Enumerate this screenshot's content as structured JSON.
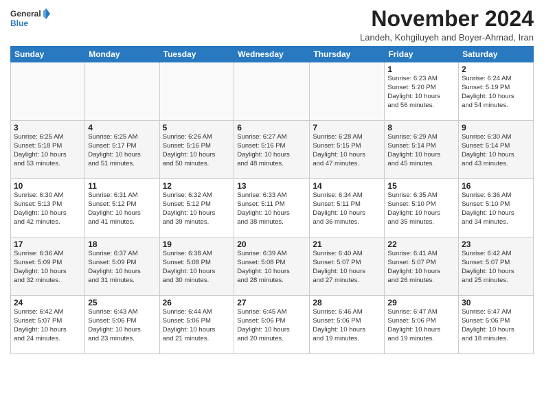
{
  "header": {
    "logo_line1": "General",
    "logo_line2": "Blue",
    "month": "November 2024",
    "location": "Landeh, Kohgiluyeh and Boyer-Ahmad, Iran"
  },
  "weekdays": [
    "Sunday",
    "Monday",
    "Tuesday",
    "Wednesday",
    "Thursday",
    "Friday",
    "Saturday"
  ],
  "weeks": [
    [
      {
        "day": "",
        "info": ""
      },
      {
        "day": "",
        "info": ""
      },
      {
        "day": "",
        "info": ""
      },
      {
        "day": "",
        "info": ""
      },
      {
        "day": "",
        "info": ""
      },
      {
        "day": "1",
        "info": "Sunrise: 6:23 AM\nSunset: 5:20 PM\nDaylight: 10 hours\nand 56 minutes."
      },
      {
        "day": "2",
        "info": "Sunrise: 6:24 AM\nSunset: 5:19 PM\nDaylight: 10 hours\nand 54 minutes."
      }
    ],
    [
      {
        "day": "3",
        "info": "Sunrise: 6:25 AM\nSunset: 5:18 PM\nDaylight: 10 hours\nand 53 minutes."
      },
      {
        "day": "4",
        "info": "Sunrise: 6:25 AM\nSunset: 5:17 PM\nDaylight: 10 hours\nand 51 minutes."
      },
      {
        "day": "5",
        "info": "Sunrise: 6:26 AM\nSunset: 5:16 PM\nDaylight: 10 hours\nand 50 minutes."
      },
      {
        "day": "6",
        "info": "Sunrise: 6:27 AM\nSunset: 5:16 PM\nDaylight: 10 hours\nand 48 minutes."
      },
      {
        "day": "7",
        "info": "Sunrise: 6:28 AM\nSunset: 5:15 PM\nDaylight: 10 hours\nand 47 minutes."
      },
      {
        "day": "8",
        "info": "Sunrise: 6:29 AM\nSunset: 5:14 PM\nDaylight: 10 hours\nand 45 minutes."
      },
      {
        "day": "9",
        "info": "Sunrise: 6:30 AM\nSunset: 5:14 PM\nDaylight: 10 hours\nand 43 minutes."
      }
    ],
    [
      {
        "day": "10",
        "info": "Sunrise: 6:30 AM\nSunset: 5:13 PM\nDaylight: 10 hours\nand 42 minutes."
      },
      {
        "day": "11",
        "info": "Sunrise: 6:31 AM\nSunset: 5:12 PM\nDaylight: 10 hours\nand 41 minutes."
      },
      {
        "day": "12",
        "info": "Sunrise: 6:32 AM\nSunset: 5:12 PM\nDaylight: 10 hours\nand 39 minutes."
      },
      {
        "day": "13",
        "info": "Sunrise: 6:33 AM\nSunset: 5:11 PM\nDaylight: 10 hours\nand 38 minutes."
      },
      {
        "day": "14",
        "info": "Sunrise: 6:34 AM\nSunset: 5:11 PM\nDaylight: 10 hours\nand 36 minutes."
      },
      {
        "day": "15",
        "info": "Sunrise: 6:35 AM\nSunset: 5:10 PM\nDaylight: 10 hours\nand 35 minutes."
      },
      {
        "day": "16",
        "info": "Sunrise: 6:36 AM\nSunset: 5:10 PM\nDaylight: 10 hours\nand 34 minutes."
      }
    ],
    [
      {
        "day": "17",
        "info": "Sunrise: 6:36 AM\nSunset: 5:09 PM\nDaylight: 10 hours\nand 32 minutes."
      },
      {
        "day": "18",
        "info": "Sunrise: 6:37 AM\nSunset: 5:09 PM\nDaylight: 10 hours\nand 31 minutes."
      },
      {
        "day": "19",
        "info": "Sunrise: 6:38 AM\nSunset: 5:08 PM\nDaylight: 10 hours\nand 30 minutes."
      },
      {
        "day": "20",
        "info": "Sunrise: 6:39 AM\nSunset: 5:08 PM\nDaylight: 10 hours\nand 28 minutes."
      },
      {
        "day": "21",
        "info": "Sunrise: 6:40 AM\nSunset: 5:07 PM\nDaylight: 10 hours\nand 27 minutes."
      },
      {
        "day": "22",
        "info": "Sunrise: 6:41 AM\nSunset: 5:07 PM\nDaylight: 10 hours\nand 26 minutes."
      },
      {
        "day": "23",
        "info": "Sunrise: 6:42 AM\nSunset: 5:07 PM\nDaylight: 10 hours\nand 25 minutes."
      }
    ],
    [
      {
        "day": "24",
        "info": "Sunrise: 6:42 AM\nSunset: 5:07 PM\nDaylight: 10 hours\nand 24 minutes."
      },
      {
        "day": "25",
        "info": "Sunrise: 6:43 AM\nSunset: 5:06 PM\nDaylight: 10 hours\nand 23 minutes."
      },
      {
        "day": "26",
        "info": "Sunrise: 6:44 AM\nSunset: 5:06 PM\nDaylight: 10 hours\nand 21 minutes."
      },
      {
        "day": "27",
        "info": "Sunrise: 6:45 AM\nSunset: 5:06 PM\nDaylight: 10 hours\nand 20 minutes."
      },
      {
        "day": "28",
        "info": "Sunrise: 6:46 AM\nSunset: 5:06 PM\nDaylight: 10 hours\nand 19 minutes."
      },
      {
        "day": "29",
        "info": "Sunrise: 6:47 AM\nSunset: 5:06 PM\nDaylight: 10 hours\nand 19 minutes."
      },
      {
        "day": "30",
        "info": "Sunrise: 6:47 AM\nSunset: 5:06 PM\nDaylight: 10 hours\nand 18 minutes."
      }
    ]
  ]
}
